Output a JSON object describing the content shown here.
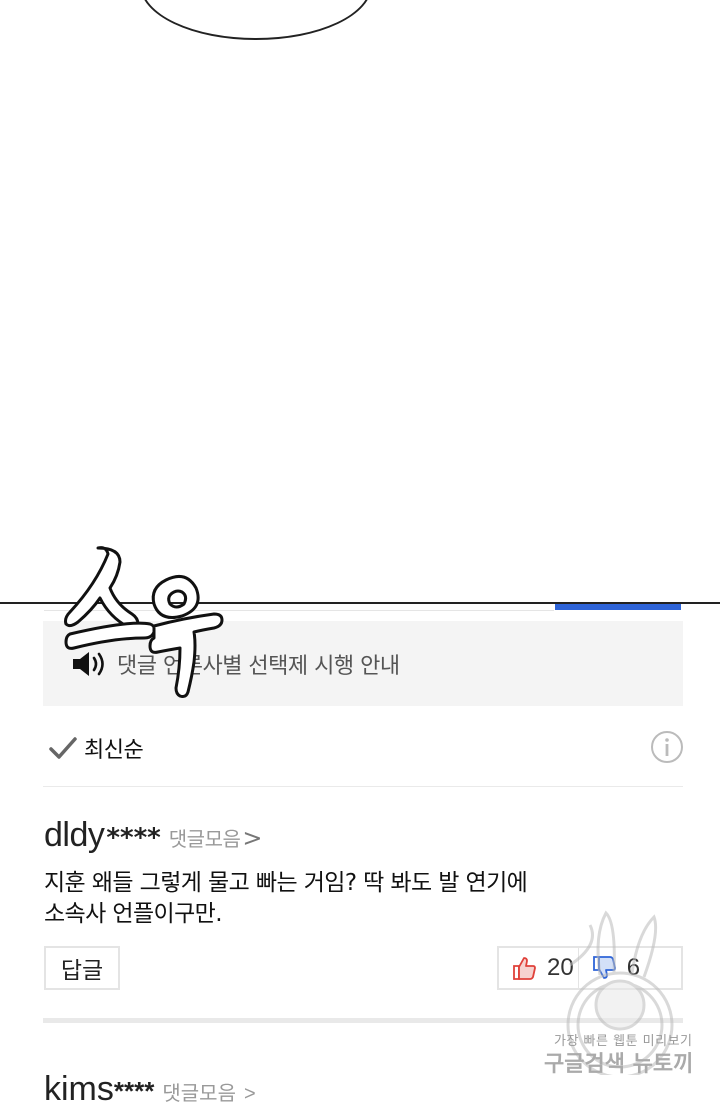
{
  "notice": {
    "text": "댓글 언론사별 선택제 시행 안내",
    "icon": "speaker-icon"
  },
  "sort": {
    "label": "최신순",
    "icon": "check-icon",
    "info_icon": "info-icon"
  },
  "comments": [
    {
      "username": "dldy",
      "mask": "****",
      "collect_label": "댓글모음",
      "collect_arrow": ">",
      "body_line1": "지훈 왜들 그렇게 물고 빠는 거임? 딱 봐도 발 연기에",
      "body_line2": "소속사 언플이구만.",
      "reply_label": "답글",
      "likes": "20",
      "dislikes": "6"
    },
    {
      "username": "kims",
      "mask": "****",
      "collect_label": "댓글모음",
      "collect_arrow": ">"
    }
  ],
  "sfx_text": "스윽",
  "watermark": {
    "line1": "가장 빠른 웹툰 미리보기",
    "line2": "구글검색 뉴토끼"
  },
  "colors": {
    "accent_blue": "#2e64d8",
    "notice_bg": "#f4f4f4",
    "like_red": "#e0413a",
    "dislike_blue": "#2e64d8"
  }
}
